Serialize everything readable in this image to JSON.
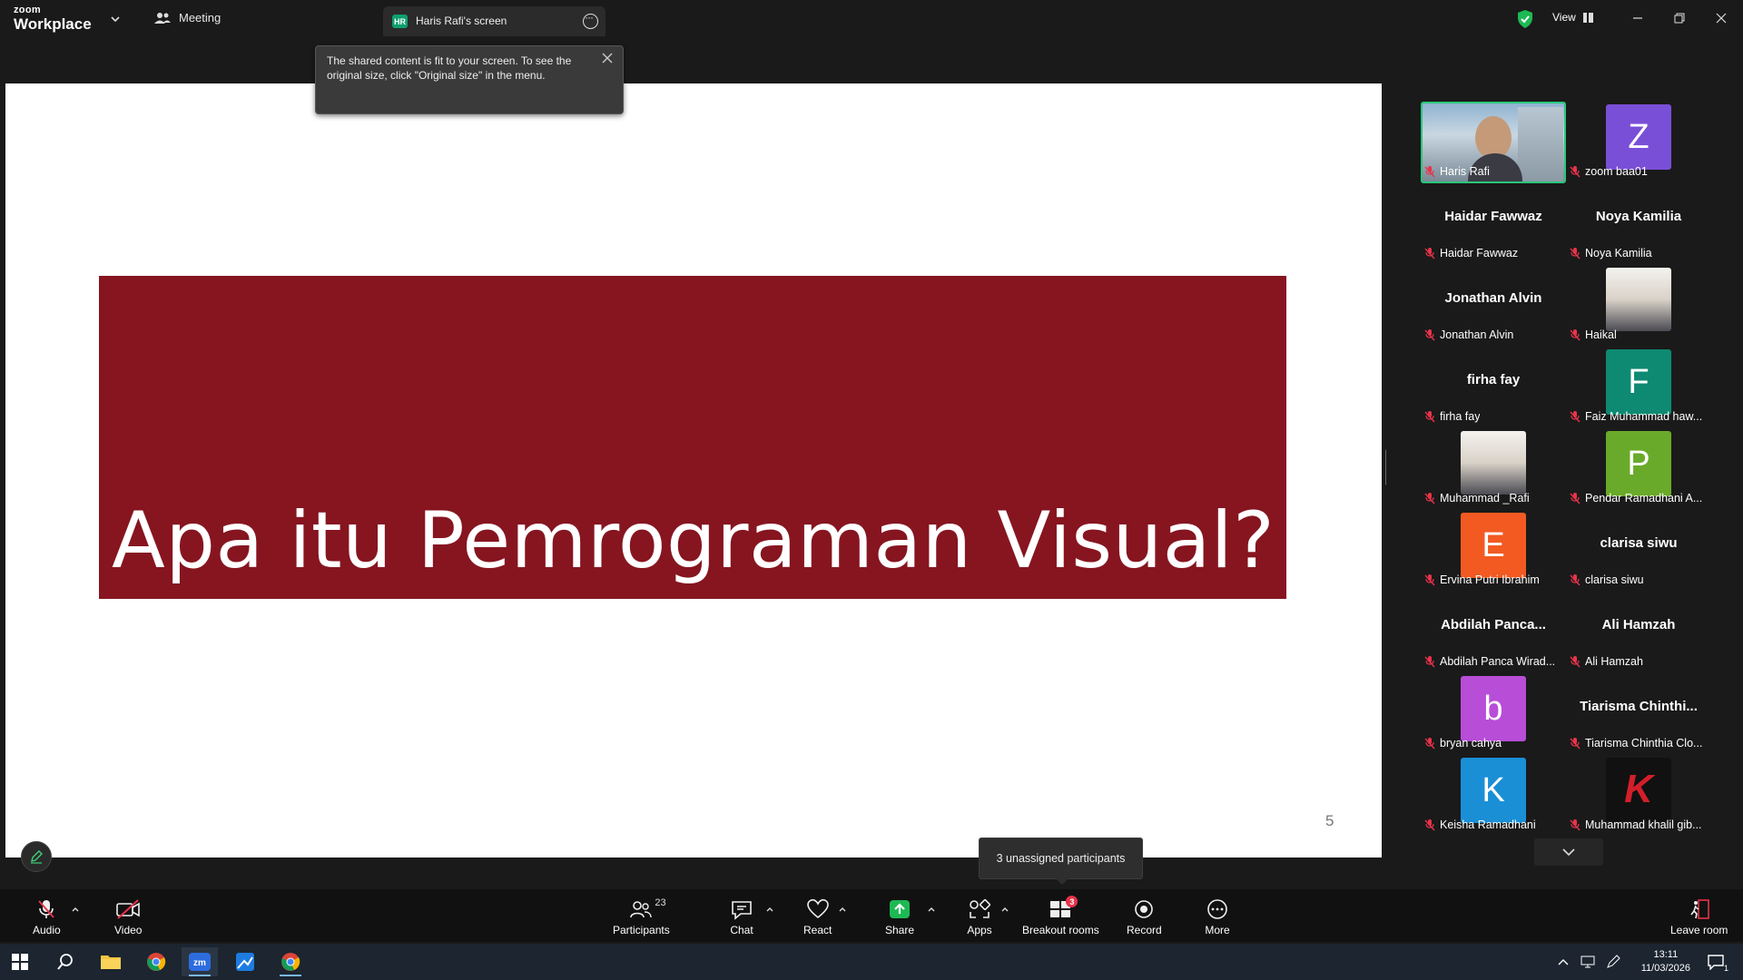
{
  "titlebar": {
    "logo_small": "zoom",
    "logo_big": "Workplace",
    "meeting_label": "Meeting",
    "screen_badge": "HR",
    "screen_tab_label": "Haris Rafi's screen",
    "view_label": "View"
  },
  "tooltip": {
    "text": "The shared content is fit to your screen. To see the original size, click \"Original size\" in the menu."
  },
  "slide": {
    "title": "Apa itu Pemrograman Visual?",
    "page_number": "5",
    "banner_color": "#861520"
  },
  "gallery": {
    "participants": [
      {
        "display": "video",
        "label": "Haris Rafi"
      },
      {
        "display": "avatar",
        "letter": "Z",
        "color": "#7a4fd8",
        "label": "zoom baa01"
      },
      {
        "display": "name",
        "big": "Haidar Fawwaz",
        "label": "Haidar Fawwaz"
      },
      {
        "display": "name",
        "big": "Noya Kamilia",
        "label": "Noya Kamilia"
      },
      {
        "display": "name",
        "big": "Jonathan Alvin",
        "label": "Jonathan Alvin"
      },
      {
        "display": "photo",
        "label": "Haikal"
      },
      {
        "display": "name",
        "big": "firha fay",
        "label": "firha fay"
      },
      {
        "display": "avatar",
        "letter": "F",
        "color": "#0e8a72",
        "label": "Faiz Muhammad haw..."
      },
      {
        "display": "photo",
        "label": "Muhammad _Rafi"
      },
      {
        "display": "avatar",
        "letter": "P",
        "color": "#6aaa2a",
        "label": "Pendar Ramadhani A..."
      },
      {
        "display": "avatar",
        "letter": "E",
        "color": "#f25a22",
        "label": "Ervina Putri Ibrahim"
      },
      {
        "display": "name",
        "big": "clarisa siwu",
        "label": "clarisa siwu"
      },
      {
        "display": "name",
        "big": "Abdilah  Panca...",
        "label": "Abdilah Panca Wirad..."
      },
      {
        "display": "name",
        "big": "Ali Hamzah",
        "label": "Ali Hamzah"
      },
      {
        "display": "avatar",
        "letter": "b",
        "color": "#b84dd8",
        "label": "bryan cahya"
      },
      {
        "display": "name",
        "big": "Tiarisma  Chinthi...",
        "label": "Tiarisma Chinthia Clo..."
      },
      {
        "display": "avatar",
        "letter": "K",
        "color": "#1a8fd6",
        "label": "Keisha Ramadhani"
      },
      {
        "display": "photo-k",
        "label": "Muhammad khalil gib..."
      }
    ]
  },
  "unassigned": {
    "text": "3 unassigned participants"
  },
  "toolbar": {
    "audio": "Audio",
    "video": "Video",
    "participants": "Participants",
    "participants_count": "23",
    "chat": "Chat",
    "react": "React",
    "share": "Share",
    "apps": "Apps",
    "breakout": "Breakout rooms",
    "breakout_badge": "3",
    "record": "Record",
    "more": "More",
    "leave": "Leave room"
  },
  "taskbar": {
    "time": "13:11",
    "date": "11/03/2026",
    "notification_count": "1"
  }
}
